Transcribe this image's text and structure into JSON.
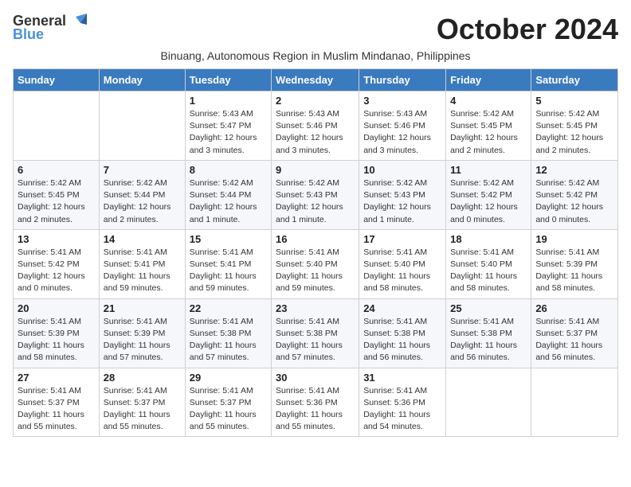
{
  "header": {
    "logo_general": "General",
    "logo_blue": "Blue",
    "month_title": "October 2024",
    "subtitle": "Binuang, Autonomous Region in Muslim Mindanao, Philippines"
  },
  "weekdays": [
    "Sunday",
    "Monday",
    "Tuesday",
    "Wednesday",
    "Thursday",
    "Friday",
    "Saturday"
  ],
  "weeks": [
    [
      {
        "day": "",
        "sunrise": "",
        "sunset": "",
        "daylight": ""
      },
      {
        "day": "",
        "sunrise": "",
        "sunset": "",
        "daylight": ""
      },
      {
        "day": "1",
        "sunrise": "Sunrise: 5:43 AM",
        "sunset": "Sunset: 5:47 PM",
        "daylight": "Daylight: 12 hours and 3 minutes."
      },
      {
        "day": "2",
        "sunrise": "Sunrise: 5:43 AM",
        "sunset": "Sunset: 5:46 PM",
        "daylight": "Daylight: 12 hours and 3 minutes."
      },
      {
        "day": "3",
        "sunrise": "Sunrise: 5:43 AM",
        "sunset": "Sunset: 5:46 PM",
        "daylight": "Daylight: 12 hours and 3 minutes."
      },
      {
        "day": "4",
        "sunrise": "Sunrise: 5:42 AM",
        "sunset": "Sunset: 5:45 PM",
        "daylight": "Daylight: 12 hours and 2 minutes."
      },
      {
        "day": "5",
        "sunrise": "Sunrise: 5:42 AM",
        "sunset": "Sunset: 5:45 PM",
        "daylight": "Daylight: 12 hours and 2 minutes."
      }
    ],
    [
      {
        "day": "6",
        "sunrise": "Sunrise: 5:42 AM",
        "sunset": "Sunset: 5:45 PM",
        "daylight": "Daylight: 12 hours and 2 minutes."
      },
      {
        "day": "7",
        "sunrise": "Sunrise: 5:42 AM",
        "sunset": "Sunset: 5:44 PM",
        "daylight": "Daylight: 12 hours and 2 minutes."
      },
      {
        "day": "8",
        "sunrise": "Sunrise: 5:42 AM",
        "sunset": "Sunset: 5:44 PM",
        "daylight": "Daylight: 12 hours and 1 minute."
      },
      {
        "day": "9",
        "sunrise": "Sunrise: 5:42 AM",
        "sunset": "Sunset: 5:43 PM",
        "daylight": "Daylight: 12 hours and 1 minute."
      },
      {
        "day": "10",
        "sunrise": "Sunrise: 5:42 AM",
        "sunset": "Sunset: 5:43 PM",
        "daylight": "Daylight: 12 hours and 1 minute."
      },
      {
        "day": "11",
        "sunrise": "Sunrise: 5:42 AM",
        "sunset": "Sunset: 5:42 PM",
        "daylight": "Daylight: 12 hours and 0 minutes."
      },
      {
        "day": "12",
        "sunrise": "Sunrise: 5:42 AM",
        "sunset": "Sunset: 5:42 PM",
        "daylight": "Daylight: 12 hours and 0 minutes."
      }
    ],
    [
      {
        "day": "13",
        "sunrise": "Sunrise: 5:41 AM",
        "sunset": "Sunset: 5:42 PM",
        "daylight": "Daylight: 12 hours and 0 minutes."
      },
      {
        "day": "14",
        "sunrise": "Sunrise: 5:41 AM",
        "sunset": "Sunset: 5:41 PM",
        "daylight": "Daylight: 11 hours and 59 minutes."
      },
      {
        "day": "15",
        "sunrise": "Sunrise: 5:41 AM",
        "sunset": "Sunset: 5:41 PM",
        "daylight": "Daylight: 11 hours and 59 minutes."
      },
      {
        "day": "16",
        "sunrise": "Sunrise: 5:41 AM",
        "sunset": "Sunset: 5:40 PM",
        "daylight": "Daylight: 11 hours and 59 minutes."
      },
      {
        "day": "17",
        "sunrise": "Sunrise: 5:41 AM",
        "sunset": "Sunset: 5:40 PM",
        "daylight": "Daylight: 11 hours and 58 minutes."
      },
      {
        "day": "18",
        "sunrise": "Sunrise: 5:41 AM",
        "sunset": "Sunset: 5:40 PM",
        "daylight": "Daylight: 11 hours and 58 minutes."
      },
      {
        "day": "19",
        "sunrise": "Sunrise: 5:41 AM",
        "sunset": "Sunset: 5:39 PM",
        "daylight": "Daylight: 11 hours and 58 minutes."
      }
    ],
    [
      {
        "day": "20",
        "sunrise": "Sunrise: 5:41 AM",
        "sunset": "Sunset: 5:39 PM",
        "daylight": "Daylight: 11 hours and 58 minutes."
      },
      {
        "day": "21",
        "sunrise": "Sunrise: 5:41 AM",
        "sunset": "Sunset: 5:39 PM",
        "daylight": "Daylight: 11 hours and 57 minutes."
      },
      {
        "day": "22",
        "sunrise": "Sunrise: 5:41 AM",
        "sunset": "Sunset: 5:38 PM",
        "daylight": "Daylight: 11 hours and 57 minutes."
      },
      {
        "day": "23",
        "sunrise": "Sunrise: 5:41 AM",
        "sunset": "Sunset: 5:38 PM",
        "daylight": "Daylight: 11 hours and 57 minutes."
      },
      {
        "day": "24",
        "sunrise": "Sunrise: 5:41 AM",
        "sunset": "Sunset: 5:38 PM",
        "daylight": "Daylight: 11 hours and 56 minutes."
      },
      {
        "day": "25",
        "sunrise": "Sunrise: 5:41 AM",
        "sunset": "Sunset: 5:38 PM",
        "daylight": "Daylight: 11 hours and 56 minutes."
      },
      {
        "day": "26",
        "sunrise": "Sunrise: 5:41 AM",
        "sunset": "Sunset: 5:37 PM",
        "daylight": "Daylight: 11 hours and 56 minutes."
      }
    ],
    [
      {
        "day": "27",
        "sunrise": "Sunrise: 5:41 AM",
        "sunset": "Sunset: 5:37 PM",
        "daylight": "Daylight: 11 hours and 55 minutes."
      },
      {
        "day": "28",
        "sunrise": "Sunrise: 5:41 AM",
        "sunset": "Sunset: 5:37 PM",
        "daylight": "Daylight: 11 hours and 55 minutes."
      },
      {
        "day": "29",
        "sunrise": "Sunrise: 5:41 AM",
        "sunset": "Sunset: 5:37 PM",
        "daylight": "Daylight: 11 hours and 55 minutes."
      },
      {
        "day": "30",
        "sunrise": "Sunrise: 5:41 AM",
        "sunset": "Sunset: 5:36 PM",
        "daylight": "Daylight: 11 hours and 55 minutes."
      },
      {
        "day": "31",
        "sunrise": "Sunrise: 5:41 AM",
        "sunset": "Sunset: 5:36 PM",
        "daylight": "Daylight: 11 hours and 54 minutes."
      },
      {
        "day": "",
        "sunrise": "",
        "sunset": "",
        "daylight": ""
      },
      {
        "day": "",
        "sunrise": "",
        "sunset": "",
        "daylight": ""
      }
    ]
  ]
}
